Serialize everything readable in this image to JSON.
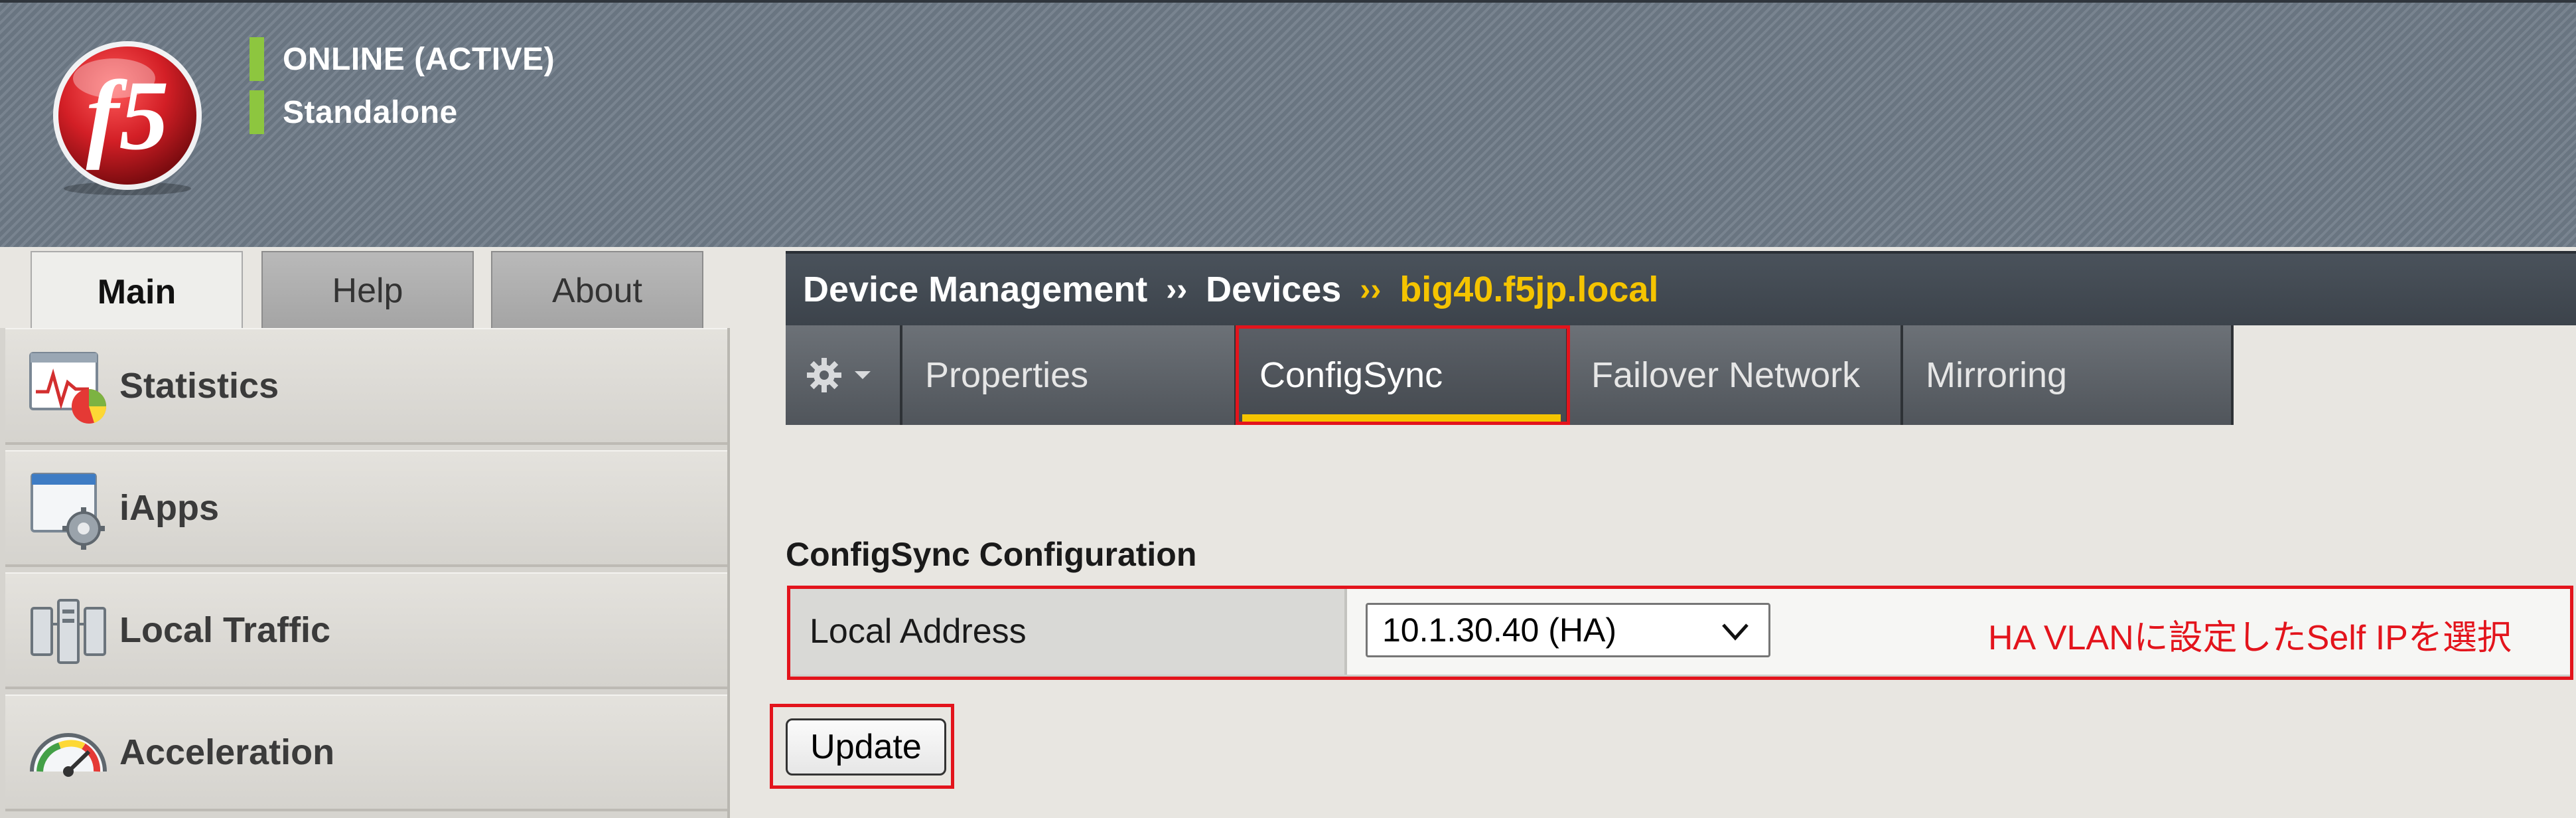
{
  "status": {
    "line1": "ONLINE (ACTIVE)",
    "line2": "Standalone",
    "indicator_color": "#8dc63f"
  },
  "logo": {
    "text": "f5",
    "color": "#d31f26"
  },
  "top_tabs": [
    {
      "label": "Main",
      "active": true
    },
    {
      "label": "Help",
      "active": false
    },
    {
      "label": "About",
      "active": false
    }
  ],
  "sidebar": {
    "items": [
      {
        "label": "Statistics",
        "icon": "statistics-chart-icon"
      },
      {
        "label": "iApps",
        "icon": "iapps-gear-icon"
      },
      {
        "label": "Local Traffic",
        "icon": "local-traffic-icon"
      },
      {
        "label": "Acceleration",
        "icon": "acceleration-gauge-icon"
      }
    ]
  },
  "breadcrumb": {
    "part1": "Device Management",
    "sep1": "››",
    "part2": "Devices",
    "sep2": "››",
    "part3": "big40.f5jp.local",
    "highlight_color": "#f5c400"
  },
  "sub_tabs": [
    {
      "label": "Properties",
      "active": false
    },
    {
      "label": "ConfigSync",
      "active": true
    },
    {
      "label": "Failover Network",
      "active": false
    },
    {
      "label": "Mirroring",
      "active": false
    }
  ],
  "configsync": {
    "title": "ConfigSync Configuration",
    "local_address_label": "Local Address",
    "local_address_value": "10.1.30.40 (HA)",
    "note": "HA VLANに設定したSelf IPを選択",
    "update_label": "Update"
  },
  "annotation_color": "#e3141c"
}
